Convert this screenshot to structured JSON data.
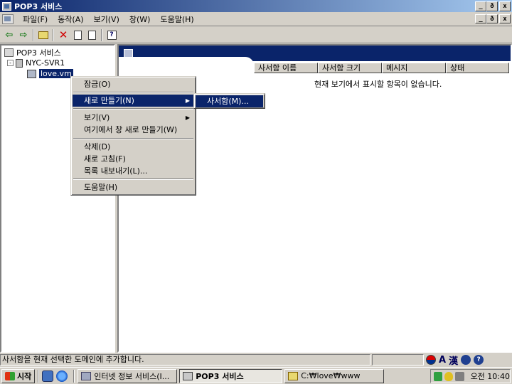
{
  "window": {
    "title": "POP3 서비스"
  },
  "caption_buttons": {
    "minimize": "_",
    "restore": "ð",
    "close": "x"
  },
  "menubar": {
    "items": [
      "파일(F)",
      "동작(A)",
      "보기(V)",
      "창(W)",
      "도움말(H)"
    ]
  },
  "toolbar": {
    "buttons": [
      "back-arrow-icon",
      "forward-arrow-icon",
      "up-folder-icon",
      "delete-icon",
      "properties-icon",
      "export-icon",
      "help-icon"
    ]
  },
  "tree": {
    "root": "POP3 서비스",
    "server": "NYC-SVR1",
    "domain": "love.vm",
    "expander": "-"
  },
  "list": {
    "columns": [
      "사서함 이름",
      "사서함 크기",
      "메시지",
      "상태"
    ],
    "empty_message": "현재 보기에서 표시할 항목이 없습니다."
  },
  "context_menu": {
    "items": [
      {
        "label": "잠금(O)"
      },
      {
        "label": "새로 만들기(N)",
        "submenu": true,
        "highlighted": true
      },
      {
        "label": "보기(V)",
        "submenu": true
      },
      {
        "label": "여기에서 창 새로 만들기(W)"
      },
      {
        "label": "삭제(D)"
      },
      {
        "label": "새로 고침(F)"
      },
      {
        "label": "목록 내보내기(L)..."
      },
      {
        "label": "도움말(H)"
      }
    ],
    "submenu_arrow": "▶"
  },
  "submenu": {
    "items": [
      "사서함(M)..."
    ]
  },
  "statusbar": {
    "text": "사서함을 현재 선택한 도메인에 추가합니다.",
    "langbar": {
      "hangul": "A",
      "hanja": "漢",
      "help": "?"
    }
  },
  "taskbar": {
    "start_label": "시작",
    "tasks": [
      {
        "label": "인터넷 정보 서비스(I...",
        "active": false
      },
      {
        "label": "POP3 서비스",
        "active": true
      },
      {
        "label": "C:₩love₩www",
        "active": false
      }
    ],
    "clock": "오전 10:40"
  }
}
